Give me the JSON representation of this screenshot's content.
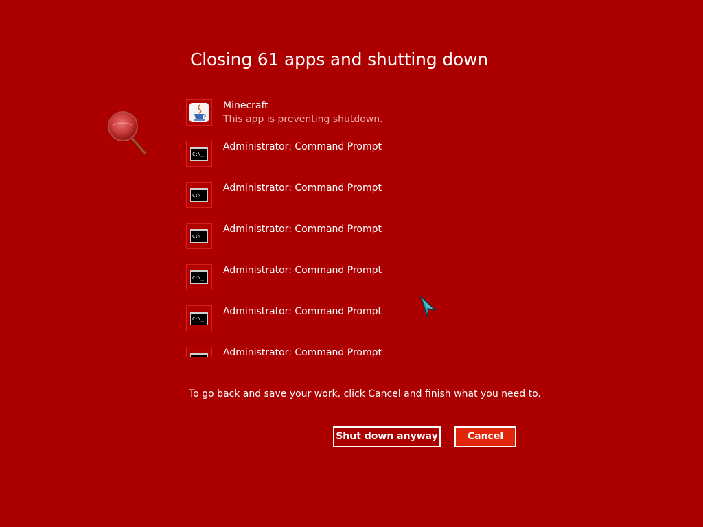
{
  "dialog": {
    "title": "Closing 61 apps and shutting down",
    "instructions": "To go back and save your work, click Cancel and finish what you need to."
  },
  "apps": [
    {
      "name": "Minecraft",
      "status": "This app is preventing shutdown.",
      "icon": "java-icon"
    },
    {
      "name": "Administrator: Command Prompt",
      "icon": "command-prompt-icon"
    },
    {
      "name": "Administrator: Command Prompt",
      "icon": "command-prompt-icon"
    },
    {
      "name": "Administrator: Command Prompt",
      "icon": "command-prompt-icon"
    },
    {
      "name": "Administrator: Command Prompt",
      "icon": "command-prompt-icon"
    },
    {
      "name": "Administrator: Command Prompt",
      "icon": "command-prompt-icon"
    },
    {
      "name": "Administrator: Command Prompt",
      "icon": "command-prompt-icon"
    }
  ],
  "cmd_icon_text": "C:\\_",
  "buttons": {
    "shutdown_label": "Shut down anyway",
    "cancel_label": "Cancel"
  },
  "colors": {
    "background": "#ac0000",
    "cancel_button": "#e2260b",
    "text": "#ffffff",
    "secondary_text": "#f0b0b0"
  }
}
